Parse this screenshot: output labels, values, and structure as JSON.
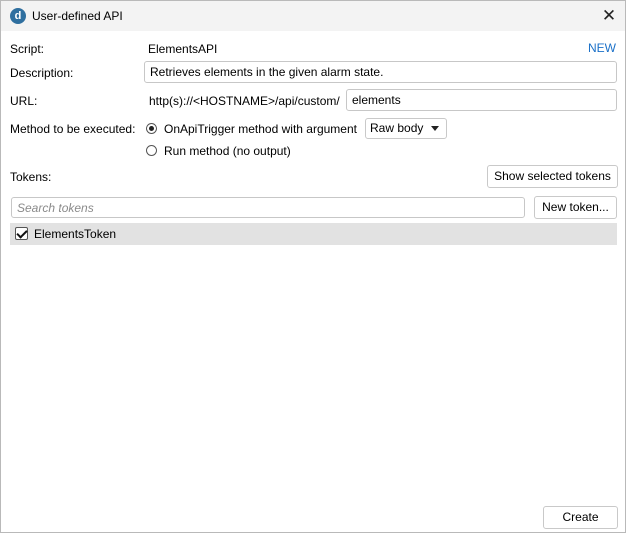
{
  "window": {
    "title": "User-defined API",
    "app_icon_letter": "d",
    "close_glyph": "✕"
  },
  "form": {
    "script_label": "Script:",
    "script_value": "ElementsAPI",
    "new_link": "NEW",
    "description_label": "Description:",
    "description_value": "Retrieves elements in the given alarm state.",
    "url_label": "URL:",
    "url_prefix": "http(s)://<HOSTNAME>/api/custom/",
    "url_value": "elements",
    "method_label": "Method to be executed:",
    "method_options": [
      {
        "label": "OnApiTrigger method with argument",
        "selected": true
      },
      {
        "label": "Run method (no output)",
        "selected": false
      }
    ],
    "argument_select": "Raw body"
  },
  "tokens": {
    "label": "Tokens:",
    "show_selected_button": "Show selected tokens",
    "search_placeholder": "Search tokens",
    "new_token_button": "New token...",
    "items": [
      {
        "name": "ElementsToken",
        "checked": true
      }
    ]
  },
  "footer": {
    "create_button": "Create"
  }
}
